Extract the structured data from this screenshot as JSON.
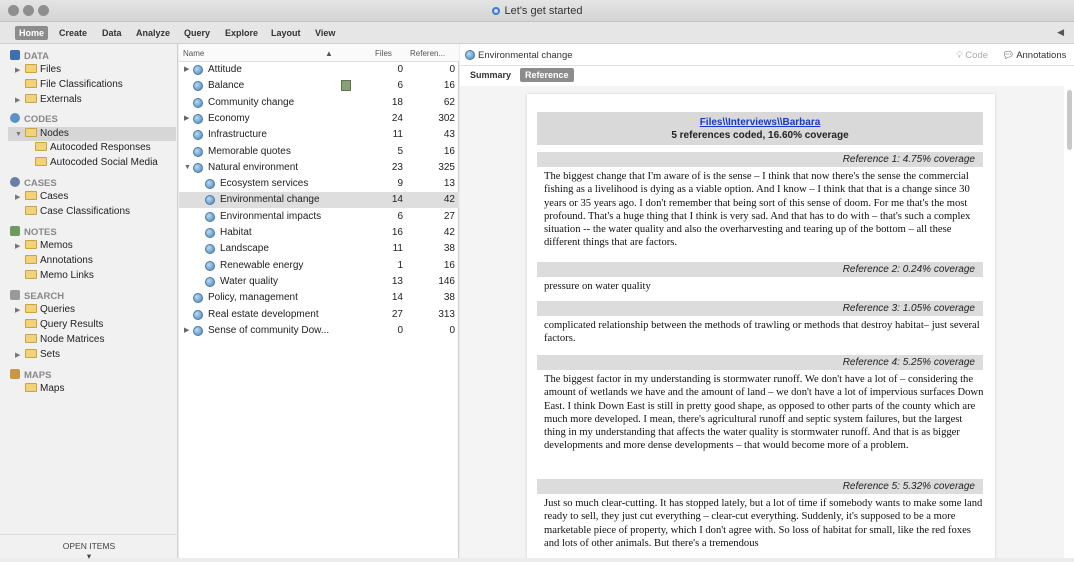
{
  "window": {
    "title": "Let's get started"
  },
  "ribbon": {
    "tabs": [
      "Home",
      "Create",
      "Data",
      "Analyze",
      "Query",
      "Explore",
      "Layout",
      "View"
    ]
  },
  "nav": {
    "sections": [
      {
        "label": "DATA",
        "color": "#3d6fb3"
      },
      {
        "label": "CODES",
        "color": "#5c93c7"
      },
      {
        "label": "CASES",
        "color": "#6a7fa3"
      },
      {
        "label": "NOTES",
        "color": "#6e9a5f"
      },
      {
        "label": "SEARCH",
        "color": "#9a9a9a"
      },
      {
        "label": "MAPS",
        "color": "#c99644"
      }
    ],
    "items": [
      "Files",
      "File Classifications",
      "Externals",
      "Nodes",
      "Autocoded Responses",
      "Autocoded Social Media",
      "Cases",
      "Case Classifications",
      "Memos",
      "Annotations",
      "Memo Links",
      "Queries",
      "Query Results",
      "Node Matrices",
      "Sets",
      "Maps"
    ],
    "open_items": "OPEN ITEMS"
  },
  "list": {
    "headers": {
      "name": "Name",
      "files": "Files",
      "refs": "Referen..."
    },
    "rows": [
      {
        "name": "Attitude",
        "files": "0",
        "refs": "0"
      },
      {
        "name": "Balance",
        "files": "6",
        "refs": "16"
      },
      {
        "name": "Community change",
        "files": "18",
        "refs": "62"
      },
      {
        "name": "Economy",
        "files": "24",
        "refs": "302"
      },
      {
        "name": "Infrastructure",
        "files": "11",
        "refs": "43"
      },
      {
        "name": "Memorable quotes",
        "files": "5",
        "refs": "16"
      },
      {
        "name": "Natural environment",
        "files": "23",
        "refs": "325"
      },
      {
        "name": "Ecosystem services",
        "files": "9",
        "refs": "13"
      },
      {
        "name": "Environmental change",
        "files": "14",
        "refs": "42"
      },
      {
        "name": "Environmental impacts",
        "files": "6",
        "refs": "27"
      },
      {
        "name": "Habitat",
        "files": "16",
        "refs": "42"
      },
      {
        "name": "Landscape",
        "files": "11",
        "refs": "38"
      },
      {
        "name": "Renewable energy",
        "files": "1",
        "refs": "16"
      },
      {
        "name": "Water quality",
        "files": "13",
        "refs": "146"
      },
      {
        "name": "Policy, management",
        "files": "14",
        "refs": "38"
      },
      {
        "name": "Real estate development",
        "files": "27",
        "refs": "313"
      },
      {
        "name": "Sense of community Dow...",
        "files": "0",
        "refs": "0"
      }
    ]
  },
  "detail": {
    "title": "Environmental change",
    "code_label": "Code",
    "annotations_label": "Annotations",
    "tabs": [
      "Summary",
      "Reference"
    ],
    "doc_link": "Files\\\\Interviews\\\\Barbara",
    "doc_summary": "5 references coded, 16.60% coverage",
    "references": [
      {
        "label": "Reference 1: 4.75% coverage",
        "text": "The biggest change that I'm aware of is the sense – I think that now there's the sense the commercial fishing as a livelihood is dying as a viable option. And I know – I think that that is a change since 30 years or 35 years ago. I don't remember that being sort of this sense of doom. For me that's the most profound. That's a huge thing that I think is very sad. And that has to do with – that's such a complex situation -- the water quality and also the overharvesting and tearing up of the bottom – all these different things that are factors."
      },
      {
        "label": "Reference 2: 0.24% coverage",
        "text": "pressure on water quality"
      },
      {
        "label": "Reference 3: 1.05% coverage",
        "text": "complicated relationship between the methods of trawling or methods that destroy habitat– just several factors."
      },
      {
        "label": "Reference 4: 5.25% coverage",
        "text": "The biggest factor in my understanding is stormwater runoff. We don't have a lot of – considering the amount of wetlands we have and the amount of land – we don't have a lot of impervious surfaces Down East. I think Down East is still in pretty good shape, as opposed to other parts of the county which are much more developed. I mean, there's agricultural runoff and septic system failures, but the largest thing in my understanding that affects the water quality is stormwater runoff. And that is as bigger developments and more dense developments – that would become more of a problem."
      },
      {
        "label": "Reference 5: 5.32% coverage",
        "text": "Just so much clear-cutting. It has stopped lately, but a lot of time if somebody wants to make some land ready to sell, they just cut everything – clear-cut everything. Suddenly, it's supposed to be a more marketable piece of property, which I don't agree with. So loss of habitat for small, like the red foxes and lots of other animals. But there's a tremendous"
      }
    ]
  }
}
